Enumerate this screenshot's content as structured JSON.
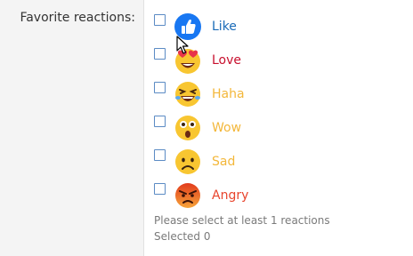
{
  "field": {
    "label": "Favorite reactions:"
  },
  "reactions": [
    {
      "label": "Like",
      "icon": "thumbs-up-icon",
      "color": "#1a6bb8",
      "checked": false
    },
    {
      "label": "Love",
      "icon": "heart-eyes-icon",
      "color": "#c8102e",
      "checked": false
    },
    {
      "label": "Haha",
      "icon": "laughing-icon",
      "color": "#f3b73a",
      "checked": false
    },
    {
      "label": "Wow",
      "icon": "surprised-icon",
      "color": "#f3b73a",
      "checked": false
    },
    {
      "label": "Sad",
      "icon": "sad-face-icon",
      "color": "#f3b73a",
      "checked": false
    },
    {
      "label": "Angry",
      "icon": "angry-face-icon",
      "color": "#e8442c",
      "checked": false
    }
  ],
  "help": {
    "validation": "Please select at least 1 reactions",
    "selected": "Selected 0"
  }
}
